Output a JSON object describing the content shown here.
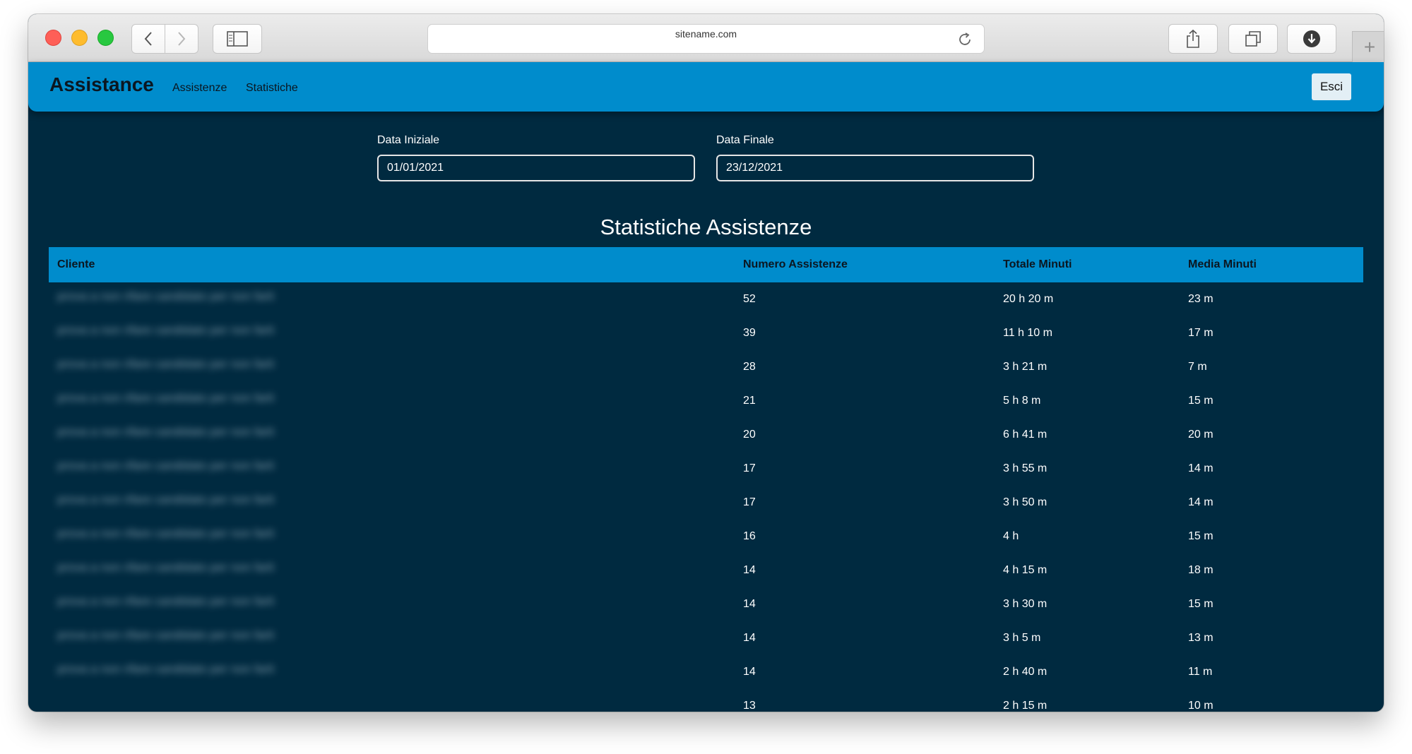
{
  "browser": {
    "url": "sitename.com"
  },
  "navbar": {
    "brand": "Assistance",
    "links": [
      "Assistenze",
      "Statistiche"
    ],
    "logout_label": "Esci"
  },
  "filters": {
    "start_label": "Data Iniziale",
    "start_value": "01/01/2021",
    "end_label": "Data Finale",
    "end_value": "23/12/2021"
  },
  "stats": {
    "title": "Statistiche Assistenze",
    "columns": [
      "Cliente",
      "Numero Assistenze",
      "Totale Minuti",
      "Media Minuti"
    ],
    "rows": [
      {
        "client": "prova a non rifare candidato per non farti",
        "count": "52",
        "total": "20 h 20 m",
        "avg": "23 m"
      },
      {
        "client": "prova a non rifare candidato per non farti",
        "count": "39",
        "total": "11 h 10 m",
        "avg": "17 m"
      },
      {
        "client": "prova a non rifare candidato per non farti",
        "count": "28",
        "total": "3 h 21 m",
        "avg": "7 m"
      },
      {
        "client": "prova a non rifare candidato per non farti",
        "count": "21",
        "total": "5 h 8 m",
        "avg": "15 m"
      },
      {
        "client": "prova a non rifare candidato per non farti",
        "count": "20",
        "total": "6 h 41 m",
        "avg": "20 m"
      },
      {
        "client": "prova a non rifare candidato per non farti",
        "count": "17",
        "total": "3 h 55 m",
        "avg": "14 m"
      },
      {
        "client": "prova a non rifare candidato per non farti",
        "count": "17",
        "total": "3 h 50 m",
        "avg": "14 m"
      },
      {
        "client": "prova a non rifare candidato per non farti",
        "count": "16",
        "total": "4 h",
        "avg": "15 m"
      },
      {
        "client": "prova a non rifare candidato per non farti",
        "count": "14",
        "total": "4 h 15 m",
        "avg": "18 m"
      },
      {
        "client": "prova a non rifare candidato per non farti",
        "count": "14",
        "total": "3 h 30 m",
        "avg": "15 m"
      },
      {
        "client": "prova a non rifare candidato per non farti",
        "count": "14",
        "total": "3 h 5 m",
        "avg": "13 m"
      },
      {
        "client": "prova a non rifare candidato per non farti",
        "count": "14",
        "total": "2 h 40 m",
        "avg": "11 m"
      },
      {
        "client": "",
        "count": "13",
        "total": "2 h 15 m",
        "avg": "10 m"
      }
    ]
  },
  "colors": {
    "accent": "#008ccc",
    "background": "#002a40"
  }
}
